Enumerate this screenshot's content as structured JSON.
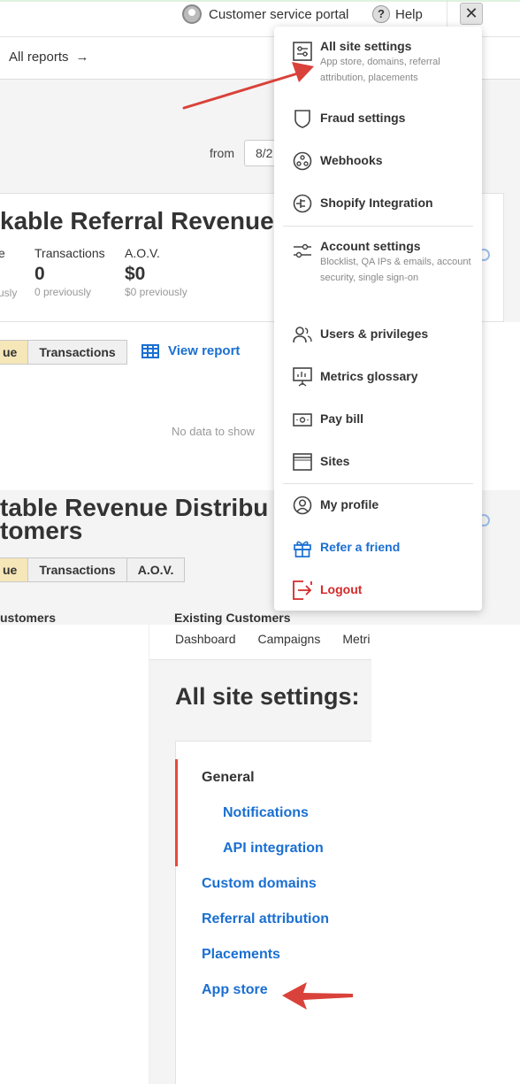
{
  "top": {
    "customer_service_portal": "Customer service portal",
    "help": "Help",
    "close_glyph": "✕",
    "all_reports": "All reports",
    "all_reports_arrow": "→",
    "from_label": "from",
    "date_value": "8/2"
  },
  "report1": {
    "title": "kable Referral Revenue",
    "metrics": [
      {
        "label": "e",
        "value": "",
        "previous": "usly"
      },
      {
        "label": "Transactions",
        "value": "0",
        "previous": "0 previously"
      },
      {
        "label": "A.O.V.",
        "value": "$0",
        "previous": "$0 previously"
      }
    ],
    "seg_buttons": [
      "ue",
      "Transactions"
    ],
    "view_report": "View report",
    "no_data": "No data to show"
  },
  "report2": {
    "title_line1": "table Revenue Distribu",
    "title_line2": "tomers",
    "seg_buttons": [
      "ue",
      "Transactions",
      "A.O.V."
    ],
    "new_customers": "ustomers",
    "existing_customers": "Existing Customers"
  },
  "menu": {
    "items": [
      {
        "label": "All site settings",
        "desc": "App store, domains, referral attribution, placements",
        "icon": "sliders-panel-icon"
      },
      {
        "label": "Fraud settings",
        "desc": "",
        "icon": "shield-icon"
      },
      {
        "label": "Webhooks",
        "desc": "",
        "icon": "webhook-icon"
      },
      {
        "label": "Shopify Integration",
        "desc": "",
        "icon": "plug-icon"
      },
      {
        "label": "Account settings",
        "desc": "Blocklist, QA IPs & emails, account security, single sign-on",
        "icon": "sliders-icon"
      },
      {
        "label": "Users & privileges",
        "desc": "",
        "icon": "users-icon"
      },
      {
        "label": "Metrics glossary",
        "desc": "",
        "icon": "presentation-icon"
      },
      {
        "label": "Pay bill",
        "desc": "",
        "icon": "bill-icon"
      },
      {
        "label": "Sites",
        "desc": "",
        "icon": "window-icon"
      },
      {
        "label": "My profile",
        "desc": "",
        "icon": "user-circle-icon"
      },
      {
        "label": "Refer a friend",
        "desc": "",
        "icon": "gift-icon"
      },
      {
        "label": "Logout",
        "desc": "",
        "icon": "logout-icon"
      }
    ]
  },
  "settings": {
    "nav_tabs": [
      "Dashboard",
      "Campaigns",
      "Metri"
    ],
    "title": "All site settings:",
    "sidebar": [
      "General",
      "Notifications",
      "API integration",
      "Custom domains",
      "Referral attribution",
      "Placements",
      "App store"
    ]
  },
  "colors": {
    "link_blue": "#1a6fd1",
    "logout_red": "#d42a2a",
    "arrow_red": "#d9423a",
    "active_seg": "#f6e7b8"
  }
}
